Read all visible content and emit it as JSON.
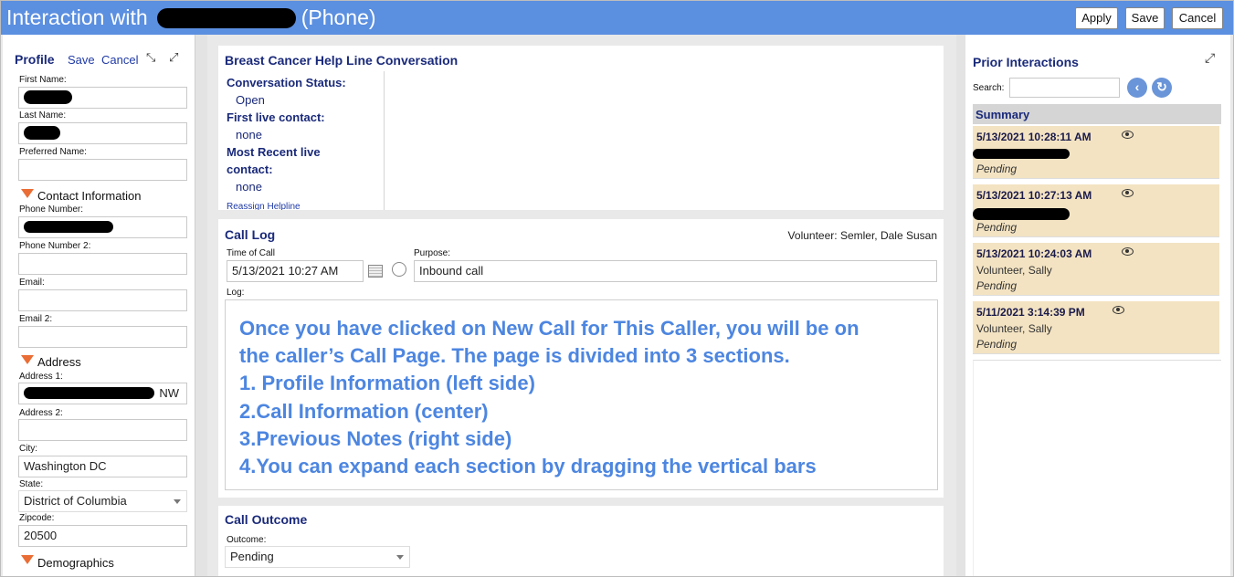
{
  "window": {
    "title_prefix": "Interaction with",
    "title_suffix": "(Phone)",
    "buttons": {
      "apply": "Apply",
      "save": "Save",
      "cancel": "Cancel"
    }
  },
  "profile": {
    "heading": "Profile",
    "save": "Save",
    "cancel": "Cancel",
    "first_name_label": "First Name:",
    "last_name_label": "Last Name:",
    "preferred_name_label": "Preferred Name:",
    "contact_section": "Contact Information",
    "phone_label": "Phone Number:",
    "phone2_label": "Phone Number 2:",
    "email_label": "Email:",
    "email2_label": "Email 2:",
    "address_section": "Address",
    "address1_label": "Address 1:",
    "address1_suffix": "NW",
    "address2_label": "Address 2:",
    "city_label": "City:",
    "city_value": "Washington DC",
    "state_label": "State:",
    "state_value": "District of Columbia",
    "zip_label": "Zipcode:",
    "zip_value": "20500",
    "demographics_section": "Demographics"
  },
  "conversation": {
    "heading": "Breast Cancer Help Line Conversation",
    "status_label": "Conversation Status:",
    "status_value": "Open",
    "first_contact_label": "First live contact:",
    "first_contact_value": "none",
    "recent_label_1": "Most Recent live",
    "recent_label_2": "contact:",
    "recent_value": "none",
    "reassign_link": "Reassign Helpline"
  },
  "call_log": {
    "heading": "Call Log",
    "volunteer_label": "Volunteer:",
    "volunteer_value": "Semler, Dale Susan",
    "time_label": "Time of Call",
    "time_value": "5/13/2021 10:27 AM",
    "purpose_label": "Purpose:",
    "purpose_value": "Inbound call",
    "log_label": "Log:",
    "log_lines": [
      "Once you have clicked on New Call for This Caller, you will be on",
      "the caller’s Call Page. The page is divided into 3 sections.",
      "1. Profile Information (left side)",
      "2.Call Information (center)",
      "3.Previous Notes (right side)",
      "4.You can expand each section by dragging the vertical bars"
    ]
  },
  "outcome": {
    "heading": "Call Outcome",
    "outcome_label": "Outcome:",
    "outcome_value": "Pending"
  },
  "prior": {
    "heading": "Prior Interactions",
    "search_label": "Search:",
    "search_value": "",
    "summary_label": "Summary",
    "cards": [
      {
        "date": "5/13/2021 10:28:11 AM",
        "name": "",
        "status": "Pending"
      },
      {
        "date": "5/13/2021 10:27:13 AM",
        "name": "",
        "status": "Pending"
      },
      {
        "date": "5/13/2021 10:24:03 AM",
        "name": "Volunteer, Sally",
        "status": "Pending"
      },
      {
        "date": "5/11/2021 3:14:39 PM",
        "name": "Volunteer, Sally",
        "status": "Pending"
      }
    ]
  },
  "colors": {
    "title_bar": "#5b8fe0",
    "section_triangle": "#ea6d35",
    "note_text": "#4d86e0",
    "card_bg": "#f3e3c2"
  }
}
